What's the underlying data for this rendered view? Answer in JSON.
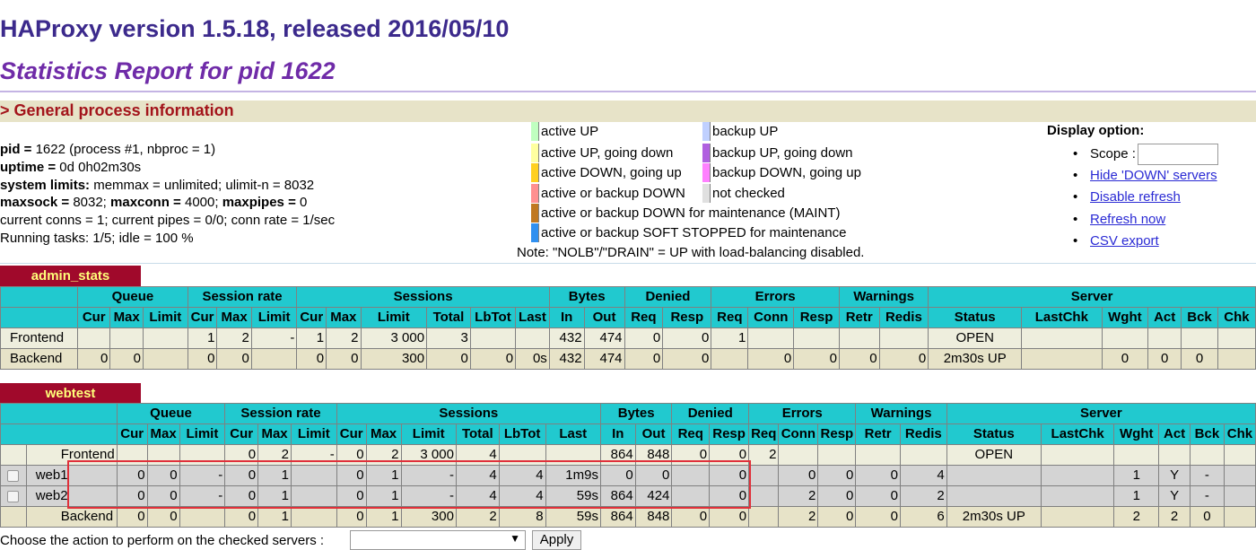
{
  "header": {
    "title": "HAProxy version 1.5.18, released 2016/05/10",
    "subtitle": "Statistics Report for pid 1622"
  },
  "general_section": {
    "title": "> General process information",
    "pid": {
      "label": "pid =",
      "value": "1622 (process #1, nbproc = 1)"
    },
    "uptime": {
      "label": "uptime =",
      "value": "0d 0h02m30s"
    },
    "system_limits": {
      "label": "system limits:",
      "value": "memmax = unlimited; ulimit-n = 8032"
    },
    "maxsock": {
      "label": "maxsock =",
      "value": "8032;",
      "maxconn_label": "maxconn =",
      "maxconn_value": "4000;",
      "maxpipes_label": "maxpipes =",
      "maxpipes_value": "0"
    },
    "conns": "current conns = 1; current pipes = 0/0; conn rate = 1/sec",
    "tasks": "Running tasks: 1/5; idle = 100 %"
  },
  "legend": {
    "items": [
      {
        "label": "active UP",
        "color": "#c0ffc0"
      },
      {
        "label": "active UP, going down",
        "color": "#ffffa0"
      },
      {
        "label": "active DOWN, going up",
        "color": "#ffd020"
      },
      {
        "label": "active or backup DOWN",
        "color": "#ff9090"
      },
      {
        "label": "active or backup DOWN for maintenance (MAINT)",
        "color": "#c07820"
      },
      {
        "label": "active or backup SOFT STOPPED for maintenance",
        "color": "#3090f0"
      },
      {
        "label": "backup UP",
        "color": "#c0d0ff"
      },
      {
        "label": "backup UP, going down",
        "color": "#b060e0"
      },
      {
        "label": "backup DOWN, going up",
        "color": "#ff80ff"
      },
      {
        "label": "not checked",
        "color": "#e0e0e0"
      }
    ],
    "note": "Note: \"NOLB\"/\"DRAIN\" = UP with load-balancing disabled."
  },
  "display_options": {
    "title": "Display option:",
    "scope_label": "Scope :",
    "links": [
      "Hide 'DOWN' servers",
      "Disable refresh",
      "Refresh now",
      "CSV export"
    ]
  },
  "groups": [
    "Queue",
    "Session rate",
    "Sessions",
    "Bytes",
    "Denied",
    "Errors",
    "Warnings",
    "Server"
  ],
  "columns": [
    "Cur",
    "Max",
    "Limit",
    "Cur",
    "Max",
    "Limit",
    "Cur",
    "Max",
    "Limit",
    "Total",
    "LbTot",
    "Last",
    "In",
    "Out",
    "Req",
    "Resp",
    "Req",
    "Conn",
    "Resp",
    "Retr",
    "Redis",
    "Status",
    "LastChk",
    "Wght",
    "Act",
    "Bck",
    "Chk"
  ],
  "admin_stats": {
    "name": "admin_stats",
    "rows": [
      {
        "name": "Frontend",
        "cells": [
          "",
          "",
          "",
          "1",
          "2",
          "-",
          "1",
          "2",
          "3 000",
          "3",
          "",
          "",
          "432",
          "474",
          "0",
          "0",
          "1",
          "",
          "",
          "",
          "",
          "OPEN",
          "",
          "",
          "",
          "",
          ""
        ]
      },
      {
        "name": "Backend",
        "cells": [
          "0",
          "0",
          "",
          "0",
          "0",
          "",
          "0",
          "0",
          "300",
          "0",
          "0",
          "0s",
          "432",
          "474",
          "0",
          "0",
          "",
          "0",
          "0",
          "0",
          "0",
          "2m30s UP",
          "",
          "0",
          "0",
          "0",
          ""
        ]
      }
    ]
  },
  "webtest": {
    "name": "webtest",
    "rows": [
      {
        "name": "Frontend",
        "cells": [
          "",
          "",
          "",
          "0",
          "2",
          "-",
          "0",
          "2",
          "3 000",
          "4",
          "",
          "",
          "864",
          "848",
          "0",
          "0",
          "2",
          "",
          "",
          "",
          "",
          "OPEN",
          "",
          "",
          "",
          "",
          ""
        ]
      },
      {
        "name": "web1",
        "cells": [
          "0",
          "0",
          "-",
          "0",
          "1",
          "",
          "0",
          "1",
          "-",
          "4",
          "4",
          "1m9s",
          "0",
          "0",
          "",
          "0",
          "",
          "0",
          "0",
          "0",
          "4",
          "",
          "",
          "1",
          "Y",
          "-",
          ""
        ]
      },
      {
        "name": "web2",
        "cells": [
          "0",
          "0",
          "-",
          "0",
          "1",
          "",
          "0",
          "1",
          "-",
          "4",
          "4",
          "59s",
          "864",
          "424",
          "",
          "0",
          "",
          "2",
          "0",
          "0",
          "2",
          "",
          "",
          "1",
          "Y",
          "-",
          ""
        ]
      },
      {
        "name": "Backend",
        "cells": [
          "0",
          "0",
          "",
          "0",
          "1",
          "",
          "0",
          "1",
          "300",
          "2",
          "8",
          "59s",
          "864",
          "848",
          "0",
          "0",
          "",
          "2",
          "0",
          "0",
          "6",
          "2m30s UP",
          "",
          "2",
          "2",
          "0",
          ""
        ]
      }
    ]
  },
  "action": {
    "label": "Choose the action to perform on the checked servers :",
    "apply_label": "Apply"
  }
}
